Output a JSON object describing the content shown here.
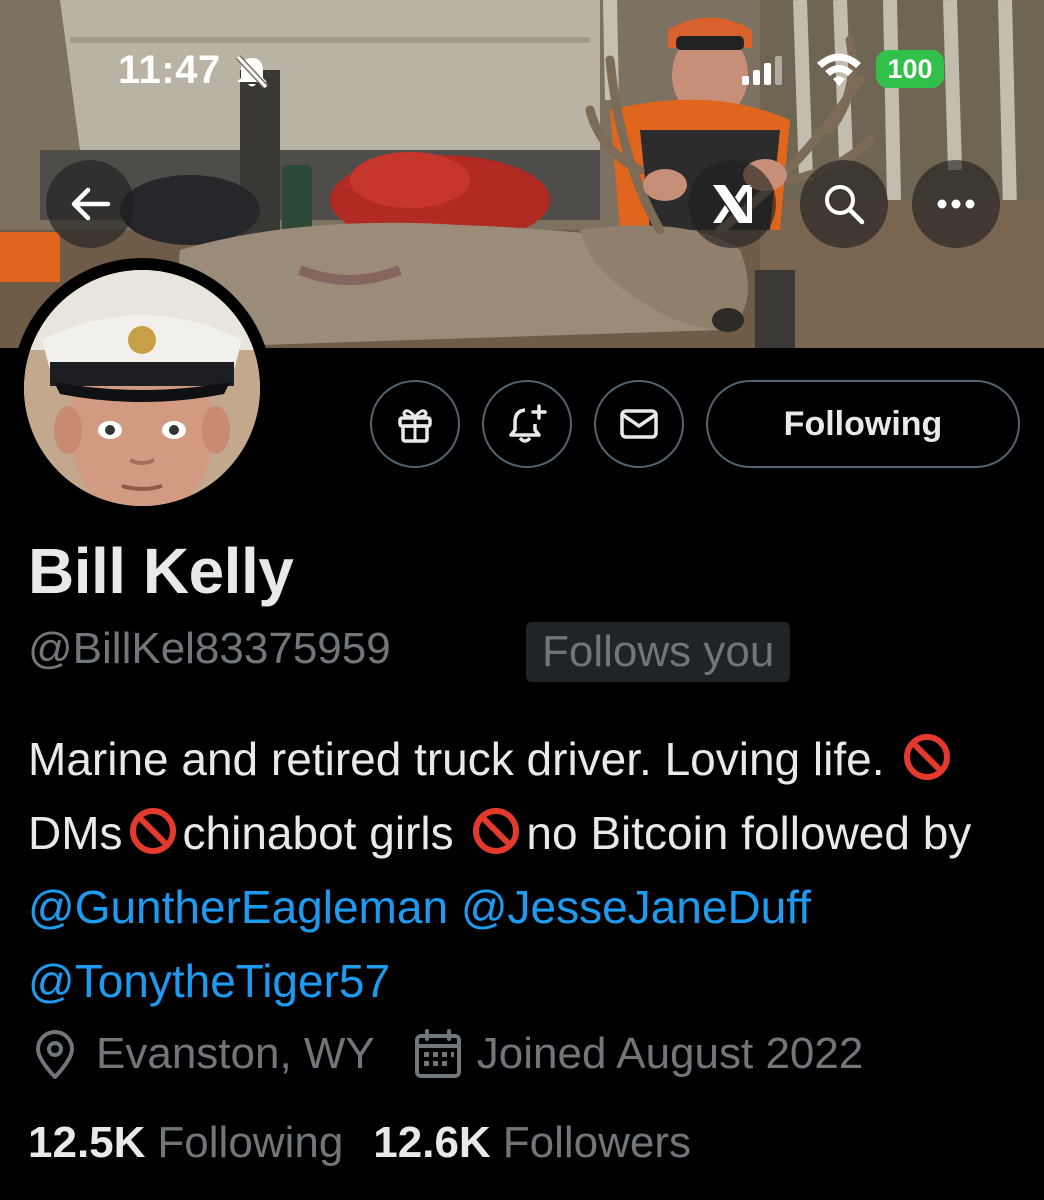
{
  "status_bar": {
    "time": "11:47",
    "battery": "100",
    "battery_color": "#31c14a"
  },
  "header": {
    "back_icon": "arrow-left-icon",
    "grok_icon": "grok-icon",
    "search_icon": "search-icon",
    "more_icon": "more-icon"
  },
  "actions": {
    "gift_icon": "gift-icon",
    "notify_icon": "bell-plus-icon",
    "message_icon": "envelope-icon",
    "following_label": "Following"
  },
  "profile": {
    "display_name": "Bill Kelly",
    "handle": "@BillKel83375959",
    "follows_you": "Follows you",
    "bio": {
      "part1": "Marine and retired truck driver. Loving life. ",
      "part2": "DMs",
      "part3": "chinabot girls ",
      "part4": "no Bitcoin followed by ",
      "mention1": "@GuntherEagleman",
      "mention2": "@JesseJaneDuff",
      "mention3": "@TonytheTiger57"
    },
    "location": "Evanston, WY",
    "joined": "Joined August 2022",
    "following_count": "12.5K",
    "following_label": "Following",
    "followers_count": "12.6K",
    "followers_label": "Followers"
  },
  "colors": {
    "accent": "#1d9bf0",
    "secondary_text": "#71767b",
    "primary_text": "#e7e9ea",
    "border": "#536471"
  }
}
